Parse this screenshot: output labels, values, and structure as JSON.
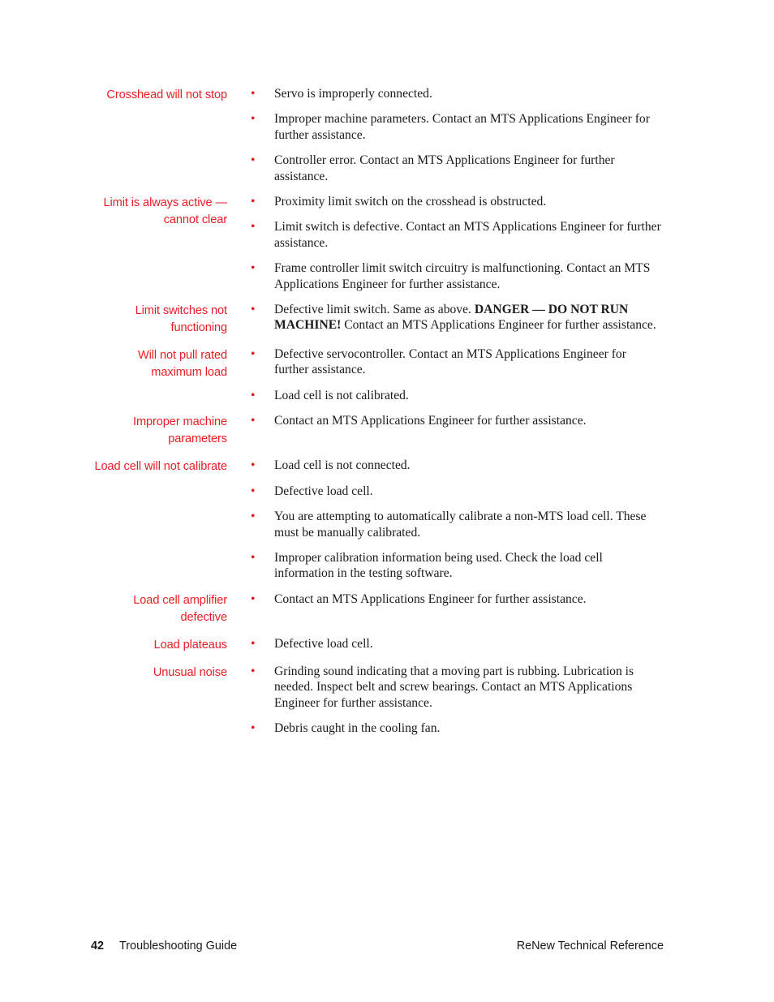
{
  "page": {
    "background_color": "#ffffff",
    "heading_color": "#ed1c24",
    "bullet_color": "#e0191f",
    "body_color": "#1a1a1a",
    "bullet_glyph": "•"
  },
  "sections": [
    {
      "heading": "Crosshead will not stop",
      "items": [
        {
          "text": "Servo is improperly connected."
        },
        {
          "text": "Improper machine parameters. Contact an MTS Applications Engineer for further assistance."
        },
        {
          "text": "Controller error. Contact an MTS Applications Engineer for further assistance."
        }
      ]
    },
    {
      "heading": "Limit is always active — cannot clear",
      "items": [
        {
          "text": "Proximity limit switch on the crosshead is obstructed."
        },
        {
          "text": "Limit switch is defective. Contact an MTS Applications Engineer for further assistance."
        },
        {
          "text": "Frame controller limit switch circuitry is malfunctioning. Contact an MTS Applications Engineer for further assistance."
        }
      ]
    },
    {
      "heading": "Limit switches not functioning",
      "items": [
        {
          "text": "Defective limit switch. Same as above. DANGER — DO NOT RUN MACHINE! Contact an MTS Applications Engineer for further assistance.",
          "runs": [
            {
              "text": "Defective limit switch. Same as above. ",
              "bold": false
            },
            {
              "text": "DANGER — DO NOT RUN MACHINE!",
              "bold": true
            },
            {
              "text": " Contact an MTS Applications Engineer for further assistance.",
              "bold": false
            }
          ]
        }
      ]
    },
    {
      "heading": "Will not pull rated maximum load",
      "items": [
        {
          "text": "Defective servocontroller. Contact an MTS Applications Engineer for further assistance."
        },
        {
          "text": "Load cell is not calibrated."
        }
      ]
    },
    {
      "heading": "Improper machine parameters",
      "items": [
        {
          "text": "Contact an MTS Applications Engineer for further assistance."
        }
      ]
    },
    {
      "heading": "Load cell will not calibrate",
      "items": [
        {
          "text": "Load cell is not connected."
        },
        {
          "text": "Defective load cell."
        },
        {
          "text": "You are attempting to automatically calibrate a non-MTS load cell. These must be manually calibrated."
        },
        {
          "text": "Improper calibration information being used. Check the load cell information in the testing software."
        }
      ]
    },
    {
      "heading": "Load cell amplifier defective",
      "items": [
        {
          "text": "Contact an MTS Applications Engineer for further assistance."
        }
      ]
    },
    {
      "heading": "Load plateaus",
      "items": [
        {
          "text": "Defective load cell."
        }
      ]
    },
    {
      "heading": "Unusual noise",
      "items": [
        {
          "text": "Grinding sound indicating that a moving part is rubbing. Lubrication is needed. Inspect belt and screw bearings. Contact an MTS Applications Engineer for further assistance."
        },
        {
          "text": "Debris caught in the cooling fan."
        }
      ]
    }
  ],
  "footer": {
    "page_number": "42",
    "section_title": "Troubleshooting Guide",
    "document_title": "ReNew Technical Reference"
  }
}
